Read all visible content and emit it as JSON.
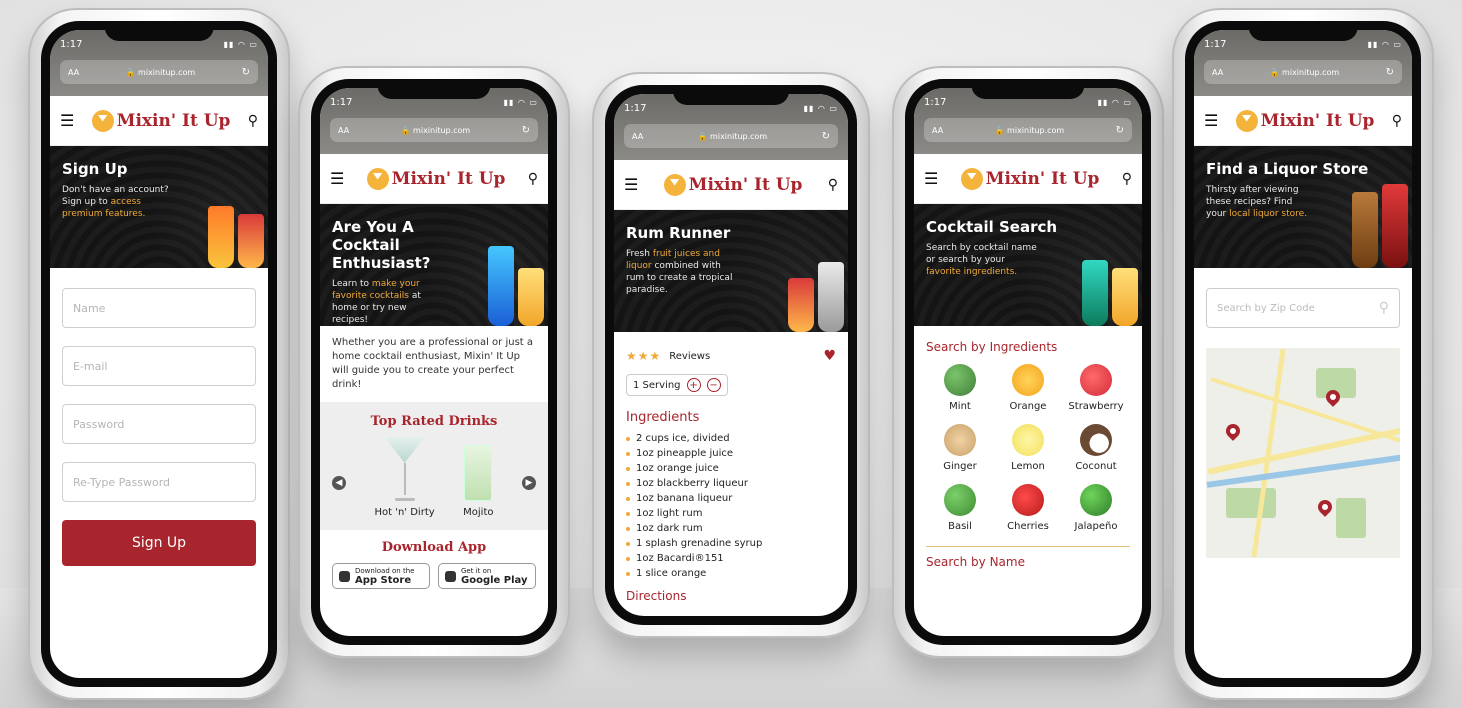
{
  "status_time": "1:17",
  "url": "mixinitup.com",
  "aa": "AA",
  "brand": "Mixin' It Up",
  "colors": {
    "brand_red": "#a8252d",
    "accent_gold": "#f0a93a"
  },
  "signup": {
    "hero_title": "Sign Up",
    "hero_text_1": "Don't have an account? Sign up to ",
    "hero_highlight": "access premium features.",
    "placeholders": [
      "Name",
      "E-mail",
      "Password",
      "Re-Type Password"
    ],
    "button": "Sign Up"
  },
  "home": {
    "hero_title": "Are You A Cocktail Enthusiast?",
    "hero_text_1": "Learn to ",
    "hero_highlight": "make your favorite cocktails",
    "hero_text_2": " at home or try new recipes!",
    "intro": "Whether you are a professional or just a home cocktail enthusiast, Mixin' It Up will guide you to create your perfect drink!",
    "top_title": "Top Rated Drinks",
    "drinks": [
      "Hot 'n' Dirty",
      "Mojito"
    ],
    "download_title": "Download App",
    "store1_small": "Download on the",
    "store1_big": "App Store",
    "store2_small": "Get it on",
    "store2_big": "Google Play"
  },
  "recipe": {
    "hero_title": "Rum Runner",
    "hero_text_1": "Fresh ",
    "hero_highlight": "fruit juices and liquor",
    "hero_text_2": " combined with rum to create a tropical paradise.",
    "stars": "★★★",
    "reviews": "Reviews",
    "serving": "1 Serving",
    "ingredients_title": "Ingredients",
    "ingredients": [
      "2 cups ice, divided",
      "1oz pineapple juice",
      "1oz orange juice",
      "1oz blackberry liqueur",
      "1oz banana liqueur",
      "1oz light rum",
      "1oz dark rum",
      "1 splash grenadine syrup",
      "1oz Bacardi®151",
      "1 slice orange"
    ],
    "directions_title": "Directions"
  },
  "search": {
    "hero_title": "Cocktail Search",
    "hero_text_1": "Search by cocktail name or search by your ",
    "hero_highlight": "favorite ingredients.",
    "section_title": "Search by Ingredients",
    "ingredients": [
      {
        "name": "Mint",
        "color": "#3f7f3a"
      },
      {
        "name": "Orange",
        "color": "#f4a21d"
      },
      {
        "name": "Strawberry",
        "color": "#d22b3a"
      },
      {
        "name": "Ginger",
        "color": "#c9a06a"
      },
      {
        "name": "Lemon",
        "color": "#f2df5a"
      },
      {
        "name": "Coconut",
        "color": "#6a4a34"
      },
      {
        "name": "Basil",
        "color": "#3e8c32"
      },
      {
        "name": "Cherries",
        "color": "#b51c1c"
      },
      {
        "name": "Jalapeño",
        "color": "#2f7d2a"
      }
    ],
    "name_title": "Search by Name"
  },
  "store": {
    "hero_title": "Find a Liquor Store",
    "hero_text_1": "Thirsty after viewing these recipes? Find your ",
    "hero_highlight": "local liquor store.",
    "zip_placeholder": "Search by Zip Code"
  }
}
